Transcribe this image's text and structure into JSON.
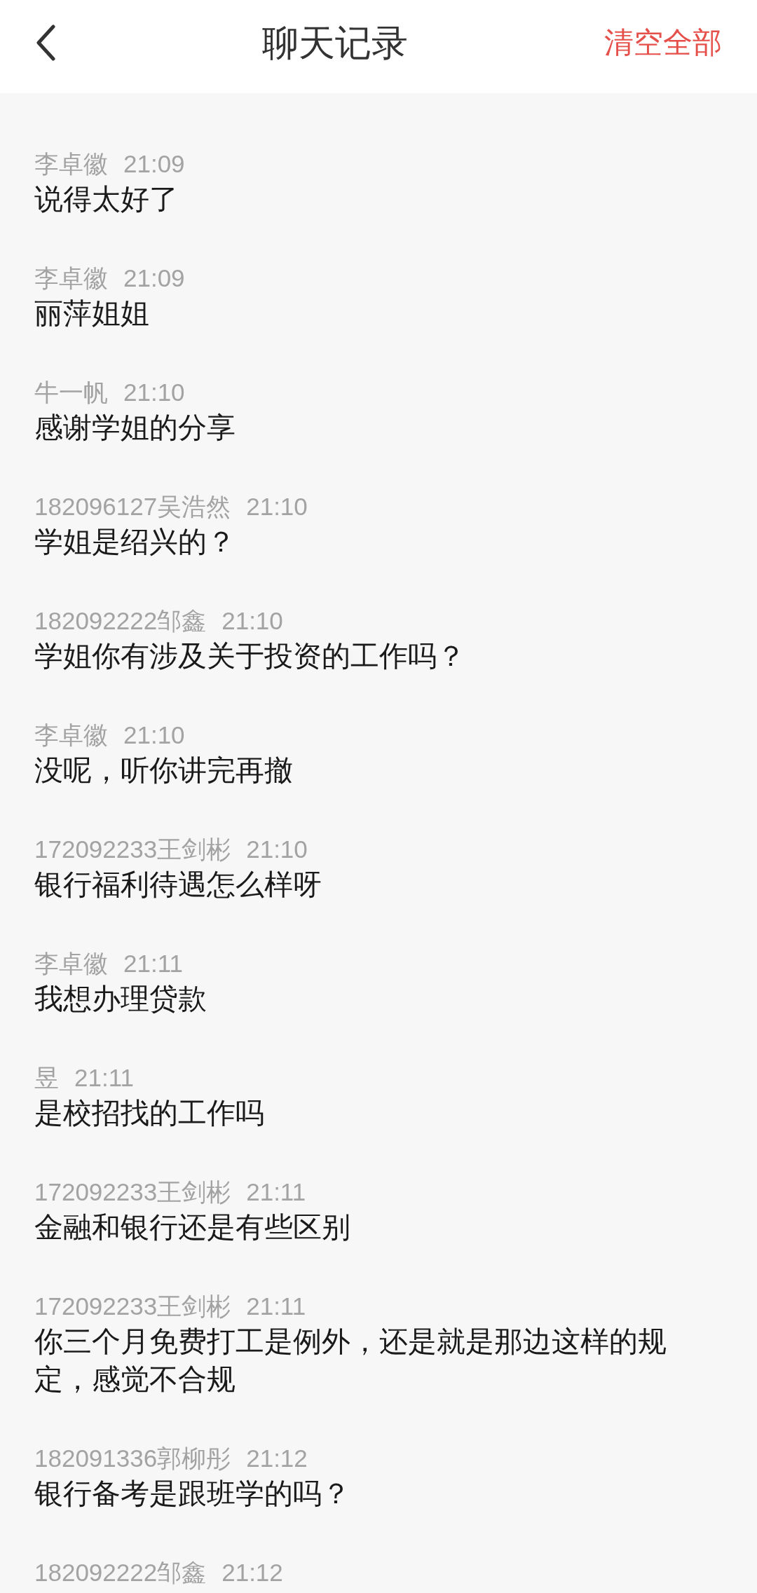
{
  "header": {
    "title": "聊天记录",
    "action": "清空全部"
  },
  "messages": [
    {
      "sender": "李卓徽",
      "time": "21:09",
      "text": "说得太好了"
    },
    {
      "sender": "李卓徽",
      "time": "21:09",
      "text": "丽萍姐姐"
    },
    {
      "sender": "牛一帆",
      "time": "21:10",
      "text": "感谢学姐的分享"
    },
    {
      "sender": "182096127吴浩然",
      "time": "21:10",
      "text": "学姐是绍兴的？"
    },
    {
      "sender": "182092222邹鑫",
      "time": "21:10",
      "text": "学姐你有涉及关于投资的工作吗？"
    },
    {
      "sender": "李卓徽",
      "time": "21:10",
      "text": "没呢，听你讲完再撤"
    },
    {
      "sender": "172092233王剑彬",
      "time": "21:10",
      "text": "银行福利待遇怎么样呀"
    },
    {
      "sender": "李卓徽",
      "time": "21:11",
      "text": "我想办理贷款"
    },
    {
      "sender": "昱",
      "time": "21:11",
      "text": "是校招找的工作吗"
    },
    {
      "sender": "172092233王剑彬",
      "time": "21:11",
      "text": "金融和银行还是有些区别"
    },
    {
      "sender": "172092233王剑彬",
      "time": "21:11",
      "text": "你三个月免费打工是例外，还是就是那边这样的规定，感觉不合规"
    },
    {
      "sender": "182091336郭柳彤",
      "time": "21:12",
      "text": "银行备考是跟班学的吗？"
    },
    {
      "sender": "182092222邹鑫",
      "time": "21:12"
    }
  ]
}
